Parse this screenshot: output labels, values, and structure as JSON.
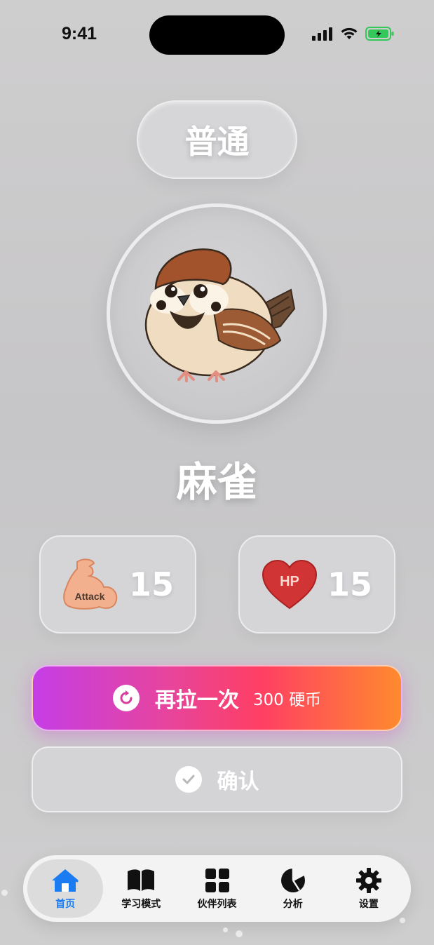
{
  "status_bar": {
    "time": "9:41"
  },
  "rarity": {
    "label": "普通"
  },
  "creature": {
    "name": "麻雀",
    "image": "sparrow"
  },
  "stats": {
    "attack": {
      "icon_text": "Attack",
      "value": "15"
    },
    "hp": {
      "icon_text": "HP",
      "value": "15"
    }
  },
  "actions": {
    "reroll": {
      "label": "再拉一次",
      "cost": "300 硬币"
    },
    "confirm": {
      "label": "确认"
    }
  },
  "tab_bar": {
    "items": [
      {
        "label": "首页",
        "icon": "home-icon",
        "active": true
      },
      {
        "label": "学习模式",
        "icon": "book-icon",
        "active": false
      },
      {
        "label": "伙伴列表",
        "icon": "grid-icon",
        "active": false
      },
      {
        "label": "分析",
        "icon": "pie-chart-icon",
        "active": false
      },
      {
        "label": "设置",
        "icon": "gear-icon",
        "active": false
      }
    ]
  },
  "colors": {
    "accent": "#1a7cf0",
    "gradient_start": "#c53ee6",
    "gradient_end": "#ff8a2e"
  }
}
